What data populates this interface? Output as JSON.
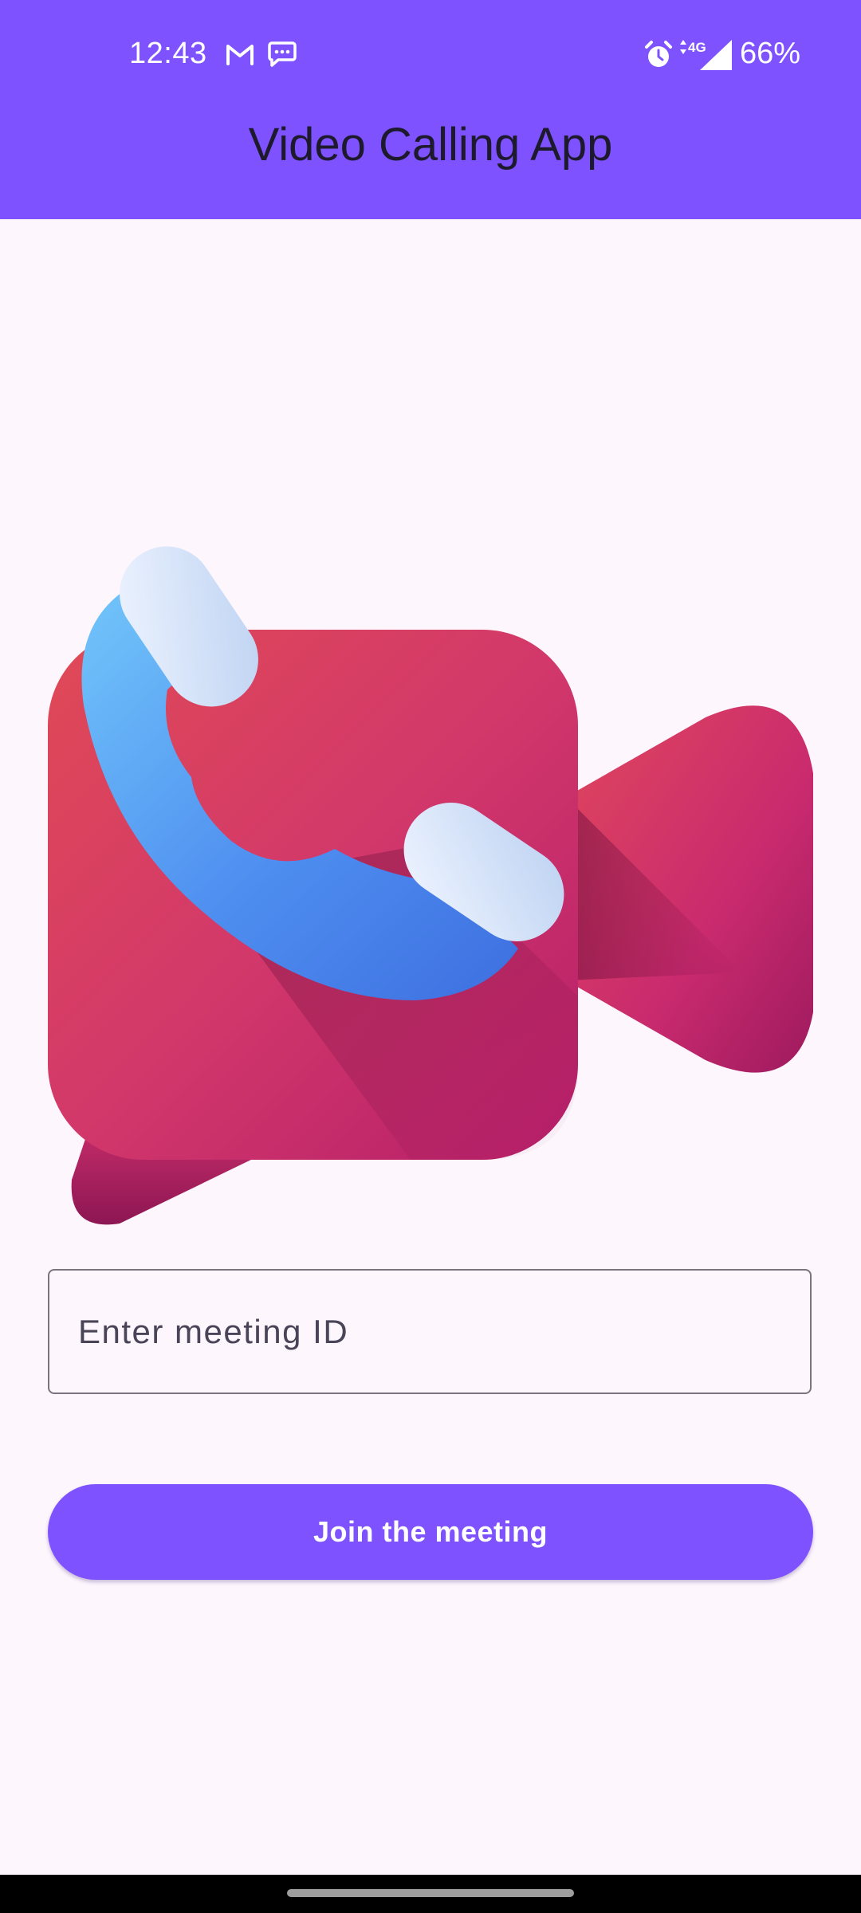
{
  "status_bar": {
    "time": "12:43",
    "battery_percent": "66%",
    "network_type": "4G",
    "icons": [
      "gmail-icon",
      "messages-icon",
      "alarm-icon",
      "network-4g-icon",
      "signal-icon"
    ]
  },
  "app_bar": {
    "title": "Video Calling App",
    "background_color": "#7F52FF"
  },
  "hero": {
    "icon": "video-call-logo-icon"
  },
  "form": {
    "meeting_id_placeholder": "Enter meeting ID",
    "meeting_id_value": "",
    "join_button_label": "Join the meeting",
    "button_color": "#7F52FF"
  },
  "navigation": {
    "handle": "gesture-handle"
  }
}
